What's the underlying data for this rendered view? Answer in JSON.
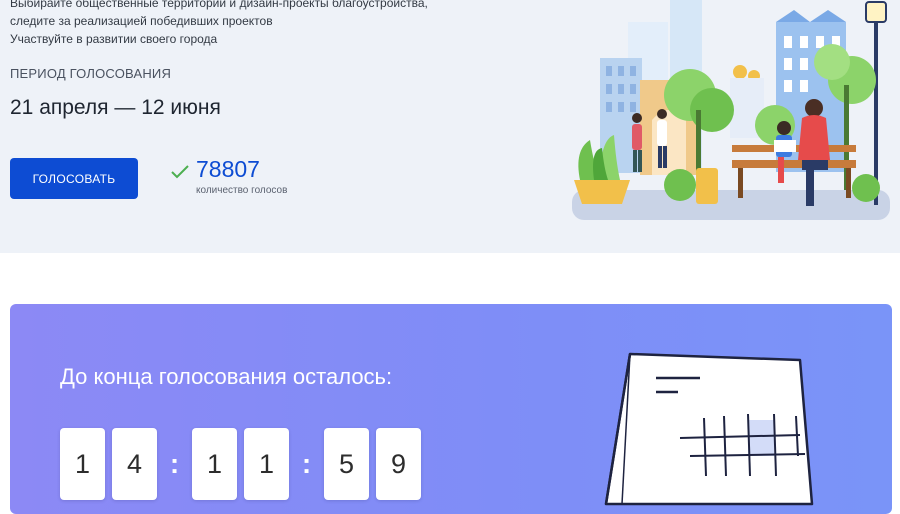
{
  "intro": {
    "line1": "Выбирайте общественные территории и дизайн-проекты благоустройства,",
    "line2": "следите за реализацией победивших проектов",
    "line3": "Участвуйте в развитии своего города"
  },
  "voting": {
    "period_label": "ПЕРИОД ГОЛОСОВАНИЯ",
    "period_dates": "21 апреля — 12 июня",
    "vote_button": "ГОЛОСОВАТЬ",
    "votes_count": "78807",
    "votes_label": "количество голосов"
  },
  "countdown": {
    "title": "До конца голосования осталось:",
    "digits": [
      "1",
      "4",
      "1",
      "1",
      "5",
      "9"
    ],
    "separator": ":"
  },
  "colors": {
    "accent": "#0d4cd3",
    "check": "#4caf50",
    "banner": "#8a8cf6",
    "top_background": "#eef2f8"
  },
  "icons": [
    "check-icon",
    "city-park-illustration",
    "calendar-illustration"
  ]
}
